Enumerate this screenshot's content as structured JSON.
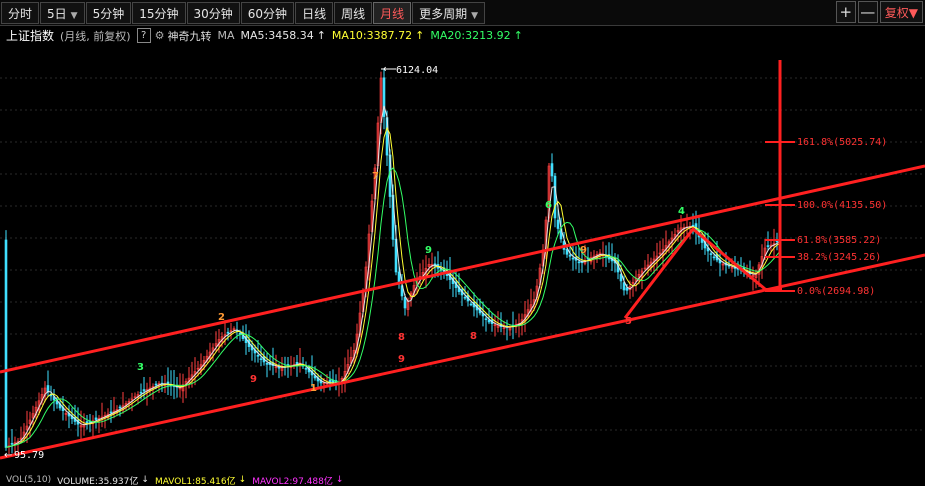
{
  "toolbar": {
    "tabs": [
      "分时",
      "5日",
      "5分钟",
      "15分钟",
      "30分钟",
      "60分钟",
      "日线",
      "周线",
      "月线",
      "更多周期"
    ],
    "active_tab": "月线",
    "plus": "+",
    "minus": "—",
    "fuquan": "复权"
  },
  "info": {
    "index_name": "上证指数",
    "period_note": "(月线, 前复权)",
    "help": "?",
    "indicator": "神奇九转",
    "ma_label": "MA",
    "ma5": "MA5:3458.34",
    "ma10": "MA10:3387.72",
    "ma20": "MA20:3213.92",
    "up_arrow": "↑",
    "colors": {
      "ma5": "#e6e6e6",
      "ma10": "#ffff33",
      "ma20": "#33ff66",
      "name": "#ffffff",
      "accent": "#ff3333"
    }
  },
  "chart": {
    "high_label": "6124.04",
    "low_label": "95.79",
    "fib": [
      {
        "ratio": "161.8%",
        "value": "5025.74"
      },
      {
        "ratio": "100.0%",
        "value": "4135.50"
      },
      {
        "ratio": "61.8%",
        "value": "3585.22"
      },
      {
        "ratio": "38.2%",
        "value": "3245.26"
      },
      {
        "ratio": "0.0%",
        "value": "2694.98"
      }
    ],
    "nine_labels": [
      "9",
      "8",
      "7",
      "6",
      "5",
      "4",
      "3",
      "2",
      "1",
      "9",
      "8",
      "9",
      "9"
    ]
  },
  "volume": {
    "label": "VOL(5,10)",
    "volume": "VOLUME:35.937亿",
    "mavol1": "MAVOL1:85.416亿",
    "mavol2": "MAVOL2:97.488亿",
    "down_arrow": "↓",
    "colors": {
      "volume": "#e6e6e6",
      "mavol1": "#ffff33",
      "mavol2": "#ff33ff"
    }
  }
}
